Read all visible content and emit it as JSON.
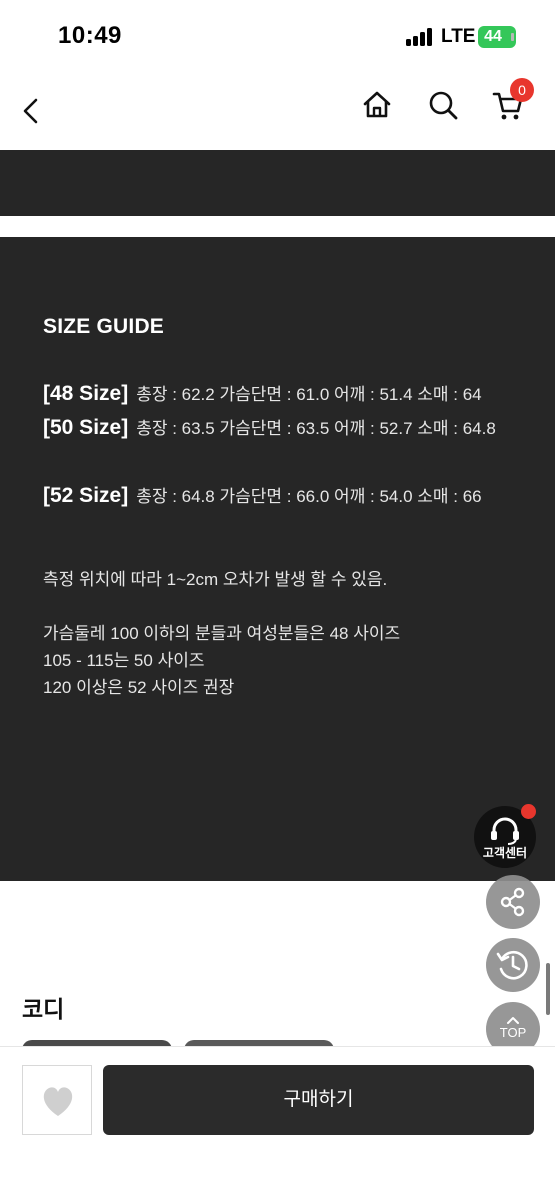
{
  "status_bar": {
    "time": "10:49",
    "network": "LTE",
    "battery": "44"
  },
  "header": {
    "cart_count": "0",
    "icons": [
      "back-icon",
      "home-icon",
      "search-icon",
      "cart-icon"
    ]
  },
  "size_guide": {
    "title": "SIZE GUIDE",
    "sizes": [
      {
        "label": "[48 Size]",
        "text": "총장 : 62.2 가슴단면 : 61.0 어깨 : 51.4 소매 : 64"
      },
      {
        "label": "[50 Size]",
        "text": "총장 : 63.5 가슴단면 : 63.5 어깨 : 52.7 소매 : 64.8"
      },
      {
        "label": "[52 Size]",
        "text": "총장 : 64.8 가슴단면 : 66.0 어깨 : 54.0 소매 : 66"
      }
    ],
    "note": "측정 위치에 따라 1~2cm 오차가 발생 할 수 있음.",
    "recommendations": [
      "가슴둘레 100 이하의 분들과 여성분들은 48 사이즈",
      "105 - 115는 50 사이즈",
      "120 이상은 52 사이즈 권장"
    ]
  },
  "coordination": {
    "title": "코디"
  },
  "floating": {
    "customer_center": "고객센터",
    "top": "TOP"
  },
  "bottom_bar": {
    "buy_label": "구매하기"
  },
  "colors": {
    "dark_background": "#262626",
    "badge_red": "#e8362d",
    "battery_green": "#34c759",
    "buy_button": "#2b2b2b"
  }
}
